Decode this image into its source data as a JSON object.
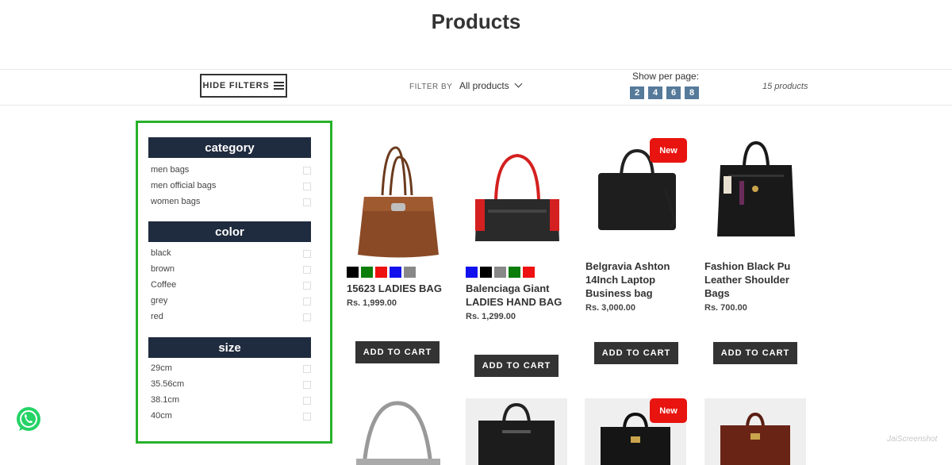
{
  "page": {
    "title": "Products"
  },
  "toolbar": {
    "hide_filters": "HIDE FILTERS",
    "filter_by": "FILTER BY",
    "filter_value": "All products",
    "per_page_label": "Show per page:",
    "per_page_options": [
      "2",
      "4",
      "6",
      "8"
    ],
    "count": "15 products"
  },
  "sidebar": {
    "groups": [
      {
        "title": "category",
        "options": [
          "men bags",
          "men official bags",
          "women bags"
        ]
      },
      {
        "title": "color",
        "options": [
          "black",
          "brown",
          "Coffee",
          "grey",
          "red"
        ]
      },
      {
        "title": "size",
        "options": [
          "29cm",
          "35.56cm",
          "38.1cm",
          "40cm"
        ]
      }
    ]
  },
  "products": [
    {
      "name": "15623 LADIES BAG",
      "price": "Rs. 1,999.00",
      "button": "ADD TO CART",
      "swatches": [
        "#000000",
        "#0a7d0a",
        "#ee1111",
        "#1111ee",
        "#888888"
      ]
    },
    {
      "name": "Balenciaga Giant LADIES HAND BAG",
      "price": "Rs. 1,299.00",
      "button": "ADD TO CART",
      "swatches": [
        "#1111ee",
        "#000000",
        "#888888",
        "#0a7d0a",
        "#ee1111"
      ]
    },
    {
      "name": "Belgravia Ashton 14Inch Laptop Business bag",
      "price": "Rs. 3,000.00",
      "button": "ADD TO CART",
      "badge": "New"
    },
    {
      "name": "Fashion Black Pu Leather Shoulder Bags",
      "price": "Rs. 700.00",
      "button": "ADD TO CART"
    }
  ],
  "row2": {
    "badge": "New"
  },
  "watermark": "JaiScreenshot",
  "colors": {
    "accent_green": "#28b12b",
    "header_navy": "#1f2b3e",
    "perpage_blue": "#557a9a",
    "badge_red": "#e8140f"
  }
}
